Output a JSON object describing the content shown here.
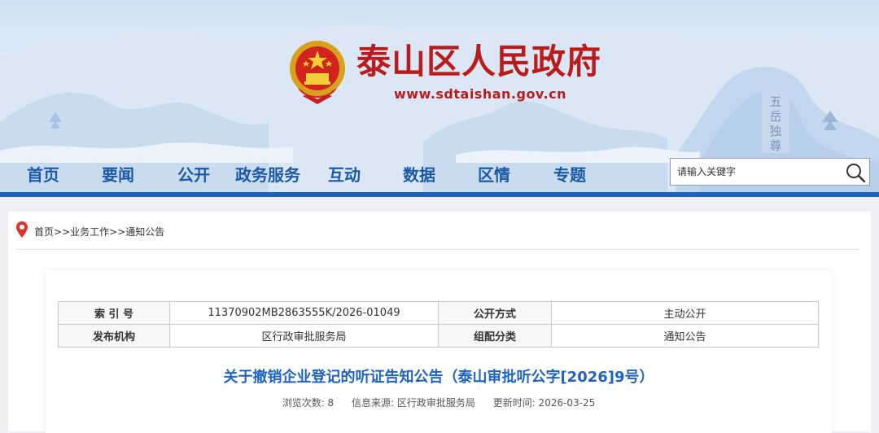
{
  "header": {
    "site_title": "泰山区人民政府",
    "site_url": "www.sdtaishan.gov.cn",
    "seal_text": "五岳独尊",
    "colors": {
      "title_red": "#b81c1c",
      "nav_blue": "#1c5aa8",
      "nav_bar": "#1f62b6"
    }
  },
  "nav": {
    "items": [
      "首页",
      "要闻",
      "公开",
      "政务服务",
      "互动",
      "数据",
      "区情",
      "专题"
    ]
  },
  "search": {
    "placeholder": "请输入关键字",
    "value": "",
    "icon": "search-icon"
  },
  "breadcrumb": {
    "icon": "location-pin-icon",
    "items": [
      "首页",
      "业务工作",
      "通知公告"
    ],
    "separator": ">>"
  },
  "meta": {
    "index_label": "索 引 号",
    "index_value": "11370902MB2863555K/2026-01049",
    "disclosure_label": "公开方式",
    "disclosure_value": "主动公开",
    "publisher_label": "发布机构",
    "publisher_value": "区行政审批服务局",
    "category_label": "组配分类",
    "category_value": "通知公告"
  },
  "article": {
    "title": "关于撤销企业登记的听证告知公告（泰山审批听公字[2026]9号）",
    "views": "浏览次数: 8",
    "source": "信息来源: 区行政审批服务局",
    "updated": "更新时间: 2026-03-25",
    "title_color": "#1d64c2"
  }
}
